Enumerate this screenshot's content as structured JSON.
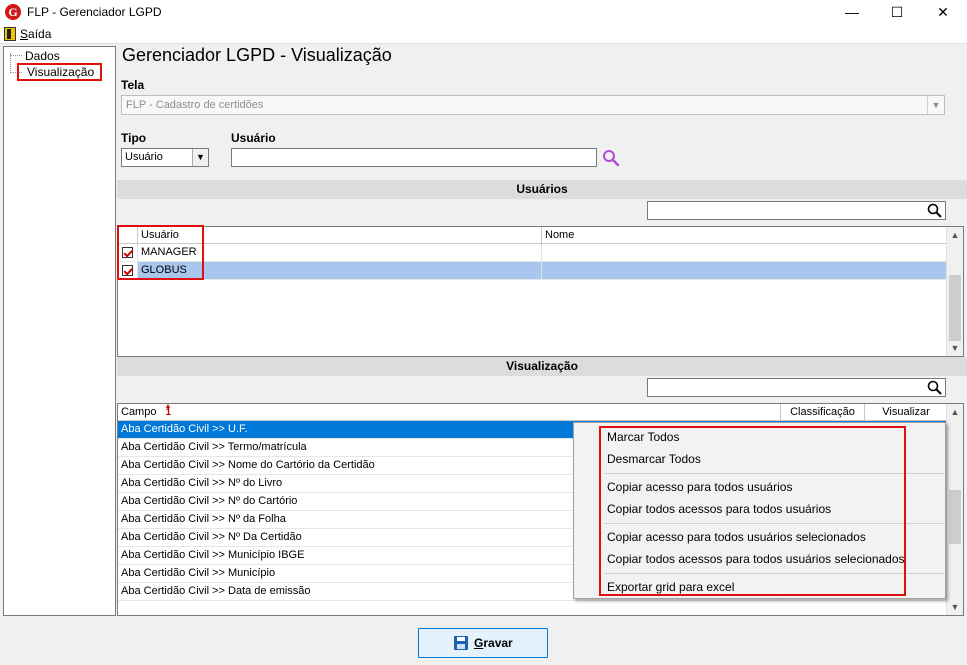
{
  "window": {
    "title": "FLP - Gerenciador LGPD",
    "app_icon": "G",
    "minimize": "—",
    "maximize": "☐",
    "close": "✕"
  },
  "menu": {
    "exit_first": "S",
    "exit_rest": "aída"
  },
  "tree": {
    "items": [
      "Dados",
      "Visualização"
    ]
  },
  "page": {
    "title": "Gerenciador LGPD - Visualização"
  },
  "form": {
    "tela_label": "Tela",
    "tela_value": "FLP - Cadastro de certidões",
    "tipo_label": "Tipo",
    "tipo_value": "Usuário",
    "usuario_label": "Usuário",
    "usuario_value": ""
  },
  "users_section": {
    "header": "Usuários",
    "columns": [
      "Usuário",
      "Nome"
    ],
    "rows": [
      {
        "usuario": "MANAGER",
        "nome": "",
        "checked": true
      },
      {
        "usuario": "GLOBUS",
        "nome": "",
        "checked": true
      }
    ]
  },
  "view_section": {
    "header": "Visualização",
    "columns": [
      "Campo",
      "Classificação",
      "Visualizar"
    ],
    "sort_index": "1",
    "rows": [
      "Aba Certidão Civil >> U.F.",
      "Aba Certidão Civil >> Termo/matrícula",
      "Aba Certidão Civil >> Nome do Cartório da Certidão",
      "Aba Certidão Civil >> Nº do Livro",
      "Aba Certidão Civil >> Nº do Cartório",
      "Aba Certidão Civil >> Nº da Folha",
      "Aba Certidão Civil >> Nº Da Certidão",
      "Aba Certidão Civil >> Município IBGE",
      "Aba Certidão Civil >> Município",
      "Aba Certidão Civil >> Data de emissão"
    ]
  },
  "context_menu": {
    "items": [
      "Marcar Todos",
      "Desmarcar Todos",
      "Copiar acesso para todos usuários",
      "Copiar todos acessos para todos usuários",
      "Copiar acesso para todos usuários selecionados",
      "Copiar todos acessos para todos usuários selecionados",
      "Exportar grid para excel"
    ]
  },
  "footer": {
    "save_first": "G",
    "save_rest": "ravar"
  },
  "colors": {
    "highlight": "#e01010",
    "selection": "#0078d7",
    "selection_light": "#a8c6ee"
  }
}
